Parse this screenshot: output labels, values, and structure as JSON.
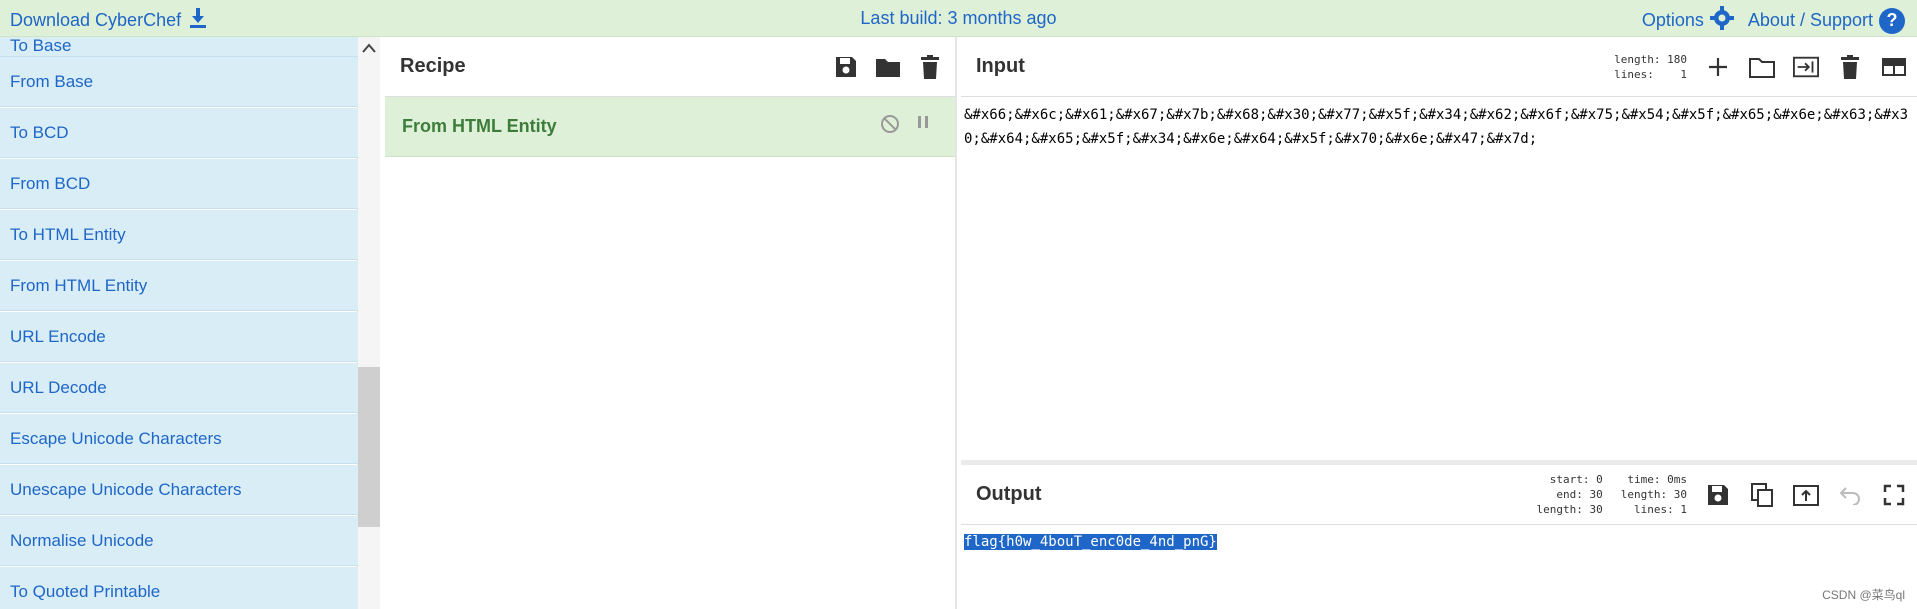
{
  "banner": {
    "download_label": "Download CyberChef",
    "build_label": "Last build: 3 months ago",
    "options_label": "Options",
    "about_label": "About / Support"
  },
  "operations": {
    "partial_item": "To Base",
    "items": [
      "From Base",
      "To BCD",
      "From BCD",
      "To HTML Entity",
      "From HTML Entity",
      "URL Encode",
      "URL Decode",
      "Escape Unicode Characters",
      "Unescape Unicode Characters",
      "Normalise Unicode",
      "To Quoted Printable"
    ]
  },
  "recipe": {
    "title": "Recipe",
    "operation": "From HTML Entity"
  },
  "input": {
    "title": "Input",
    "length_label": "length:",
    "length_value": "180",
    "lines_label": "lines:",
    "lines_value": "1",
    "text": "&#x66;&#x6c;&#x61;&#x67;&#x7b;&#x68;&#x30;&#x77;&#x5f;&#x34;&#x62;&#x6f;&#x75;&#x54;&#x5f;&#x65;&#x6e;&#x63;&#x30;&#x64;&#x65;&#x5f;&#x34;&#x6e;&#x64;&#x5f;&#x70;&#x6e;&#x47;&#x7d;"
  },
  "output": {
    "title": "Output",
    "start_label": "start:",
    "start_value": "0",
    "end_label": "end:",
    "end_value": "30",
    "length_label": "length:",
    "length_value": "30",
    "time_label": "time:",
    "time_value": "0ms",
    "length2_label": "length:",
    "length2_value": "30",
    "lines_label": "lines:",
    "lines_value": "1",
    "text": "flag{h0w_4bouT_enc0de_4nd_pnG}"
  },
  "watermark": "CSDN @菜鸟ql",
  "colors": {
    "accent": "#1e66c7",
    "banner_bg": "#dff0d8",
    "ops_bg": "#d9edf7",
    "recipe_op_text": "#3c7d3a"
  }
}
